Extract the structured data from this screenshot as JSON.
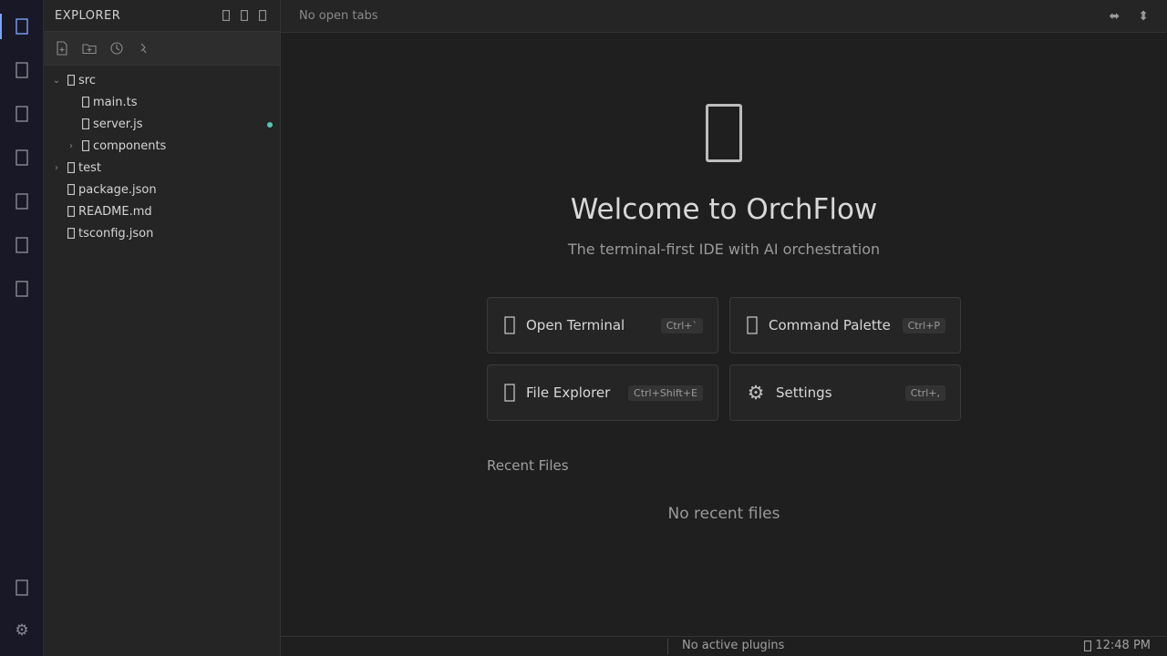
{
  "activity_bar": {
    "icons": [
      "files-icon",
      "search-icon",
      "git-icon",
      "terminal-icon",
      "extensions-icon",
      "debug-icon",
      "ai-icon"
    ],
    "bottom_icons": [
      "account-icon",
      "settings-gear-icon"
    ],
    "gear_glyph": "⚙"
  },
  "sidebar": {
    "title": "EXPLORER",
    "tree": [
      {
        "name": "src",
        "expanded": true,
        "depth": 0,
        "type": "folder"
      },
      {
        "name": "main.ts",
        "depth": 1,
        "type": "file"
      },
      {
        "name": "server.js",
        "depth": 1,
        "type": "file",
        "modified": true
      },
      {
        "name": "components",
        "expanded": false,
        "depth": 1,
        "type": "folder"
      },
      {
        "name": "test",
        "expanded": false,
        "depth": 0,
        "type": "folder"
      },
      {
        "name": "package.json",
        "depth": 0,
        "type": "file"
      },
      {
        "name": "README.md",
        "depth": 0,
        "type": "file"
      },
      {
        "name": "tsconfig.json",
        "depth": 0,
        "type": "file"
      }
    ],
    "chevron_open": "⌄",
    "chevron_closed": "›"
  },
  "tabs": {
    "empty_label": "No open tabs",
    "split_h_glyph": "⬌",
    "split_v_glyph": "⬍"
  },
  "welcome": {
    "title": "Welcome to OrchFlow",
    "subtitle": "The terminal-first IDE with AI orchestration",
    "actions": [
      {
        "label": "Open Terminal",
        "shortcut": "Ctrl+`",
        "icon": "terminal-icon"
      },
      {
        "label": "Command Palette",
        "shortcut": "Ctrl+P",
        "icon": "command-icon"
      },
      {
        "label": "File Explorer",
        "shortcut": "Ctrl+Shift+E",
        "icon": "folder-icon"
      },
      {
        "label": "Settings",
        "shortcut": "Ctrl+,",
        "icon": "settings-gear-icon",
        "glyph": "⚙"
      }
    ],
    "recent_title": "Recent Files",
    "recent_empty": "No recent files"
  },
  "status": {
    "plugins": "No active plugins",
    "time": "12:48 PM"
  },
  "colors": {
    "accent": "#7aa2f7",
    "modified_dot": "#4ec9b0",
    "background": "#1f1f1f",
    "sidebar": "#252526"
  }
}
